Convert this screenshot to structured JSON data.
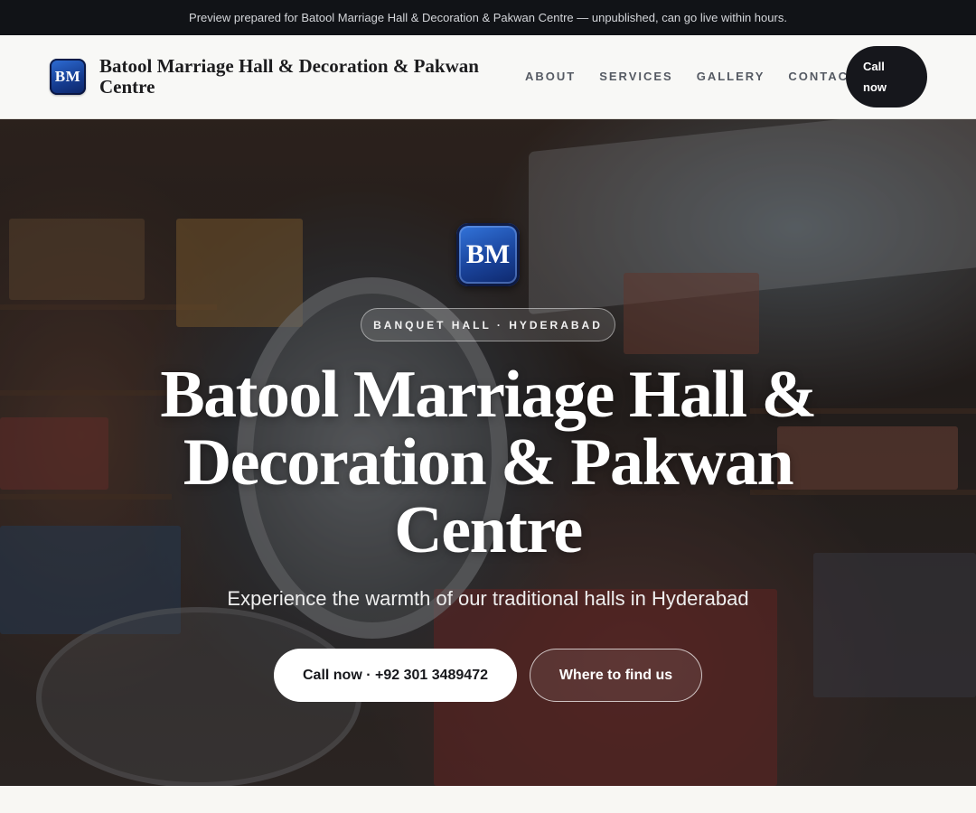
{
  "preview_bar": {
    "text": "Preview prepared for Batool Marriage Hall & Decoration & Pakwan Centre — unpublished, can go live within hours."
  },
  "header": {
    "logo_initials": "BM",
    "brand_name": "Batool Marriage Hall & Decoration & Pakwan Centre",
    "nav": [
      "ABOUT",
      "SERVICES",
      "GALLERY",
      "CONTACT"
    ],
    "call_button": "Call now"
  },
  "hero": {
    "logo_initials": "BM",
    "eyebrow": "BANQUET HALL · HYDERABAD",
    "title": "Batool Marriage Hall & Decoration & Pakwan Centre",
    "subtitle": "Experience the warmth of our traditional halls in Hyderabad",
    "primary_button": "Call now · +92 301 3489472",
    "secondary_button": "Where to find us"
  },
  "colors": {
    "preview_bar_bg": "#111317",
    "header_bg": "#f8f8f6",
    "call_button_bg": "#16171c",
    "logo_blue": "#1a449c"
  }
}
